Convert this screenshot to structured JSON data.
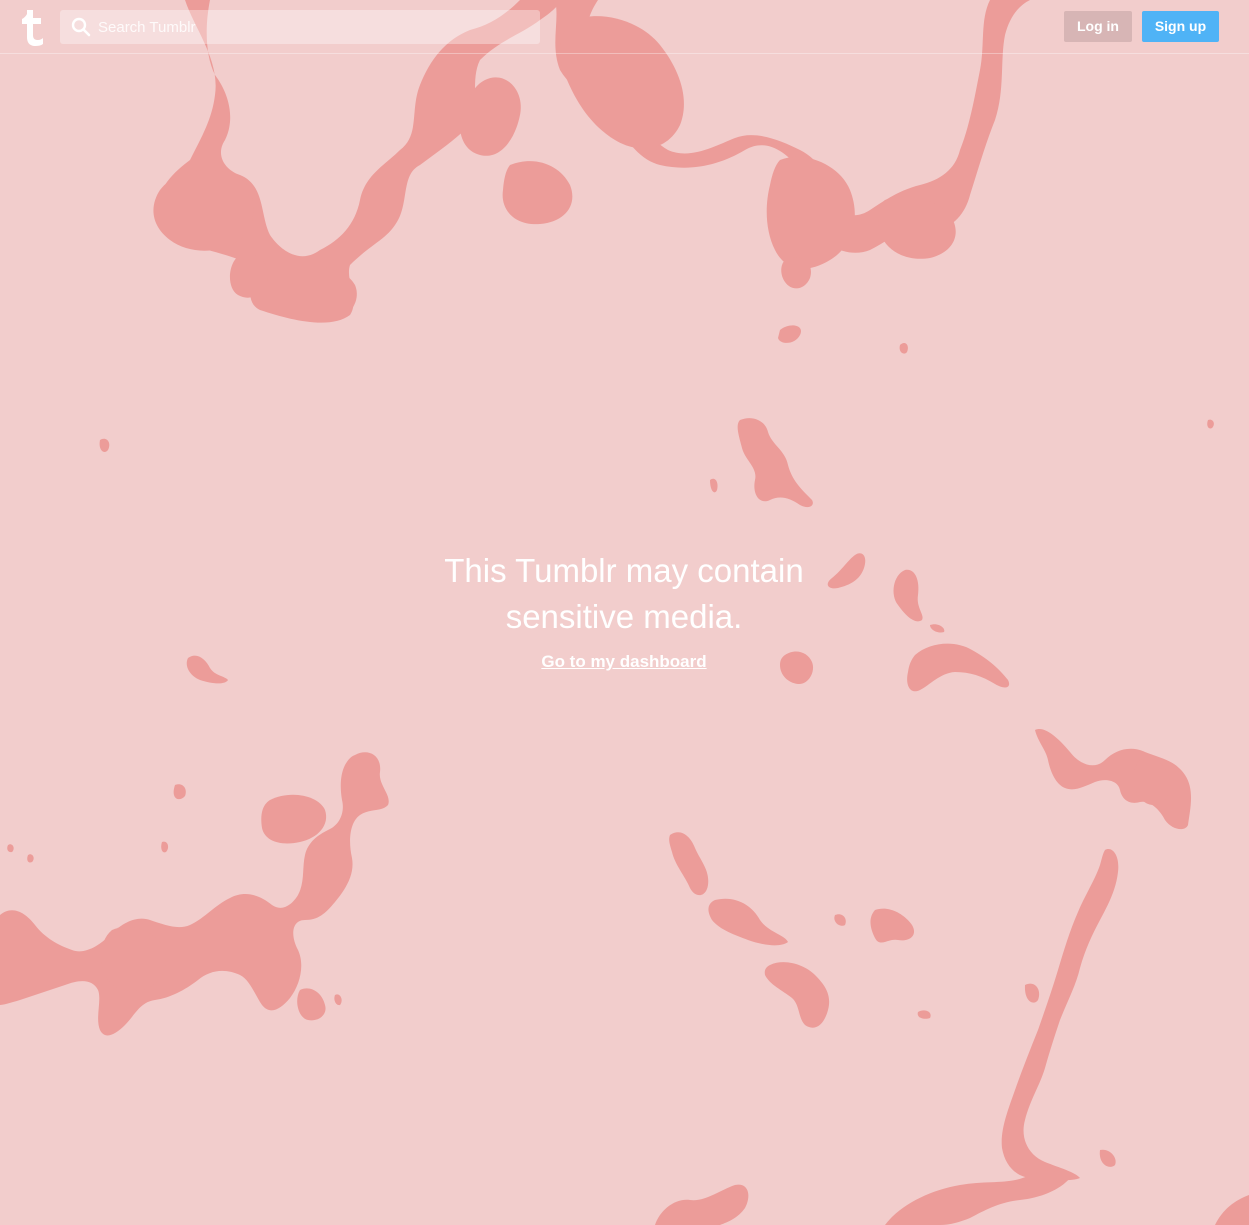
{
  "colors": {
    "background": "#f2cdcc",
    "blob": "#ec9c99",
    "signup_button": "#4fb3f6",
    "login_button": "#d7b5b5",
    "text": "#ffffff"
  },
  "header": {
    "logo_icon": "tumblr-logo-icon",
    "search": {
      "icon": "search-icon",
      "placeholder": "Search Tumblr",
      "value": ""
    },
    "login_label": "Log in",
    "signup_label": "Sign up"
  },
  "main": {
    "headline_line1": "This Tumblr may contain",
    "headline_line2": "sensitive media.",
    "dashboard_link": "Go to my dashboard"
  }
}
